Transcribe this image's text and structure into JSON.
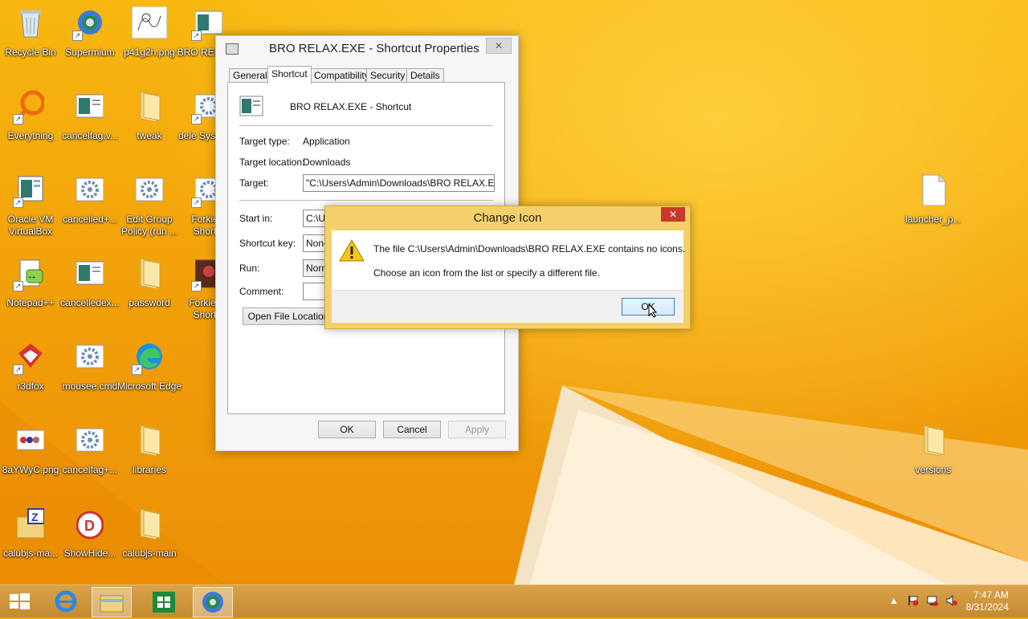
{
  "desktop_icons": [
    {
      "label": "Recycle Bin",
      "icon": "recycle-bin-icon"
    },
    {
      "label": "Supermium",
      "icon": "supermium-icon"
    },
    {
      "label": "p41g2h.png",
      "icon": "image-file-icon"
    },
    {
      "label": "BRO RELAX...",
      "icon": "exe-file-icon"
    },
    {
      "label": "Everything",
      "icon": "everything-search-icon"
    },
    {
      "label": "cancelfag.v...",
      "icon": "window-file-icon"
    },
    {
      "label": "tweak",
      "icon": "folder-icon"
    },
    {
      "label": "dele System...",
      "icon": "gear-file-icon"
    },
    {
      "label": "Oracle VM VirtualBox",
      "icon": "virtualbox-icon"
    },
    {
      "label": "cancelled+...",
      "icon": "gear-file-icon"
    },
    {
      "label": "Edit Group Policy (run ...",
      "icon": "gear-file-icon"
    },
    {
      "label": "Forkie... Short...",
      "icon": "gear-file-icon"
    },
    {
      "label": "Notepad++",
      "icon": "notepad-plus-plus-icon"
    },
    {
      "label": "cancelledex...",
      "icon": "window-file-icon"
    },
    {
      "label": "password",
      "icon": "folder-icon"
    },
    {
      "label": "Forkie.j... Short...",
      "icon": "image-file-icon"
    },
    {
      "label": "r3dfox",
      "icon": "r3dfox-icon"
    },
    {
      "label": "mousee.cmd",
      "icon": "gear-file-icon"
    },
    {
      "label": "Microsoft Edge",
      "icon": "edge-icon"
    },
    {
      "label": "8aYWyC.png",
      "icon": "image-file-icon"
    },
    {
      "label": "cancelfag+...",
      "icon": "gear-file-icon"
    },
    {
      "label": "libraries",
      "icon": "folder-icon"
    },
    {
      "label": "calubjs-ma...",
      "icon": "zip-folder-icon"
    },
    {
      "label": "ShowHide...",
      "icon": "showhide-icon"
    },
    {
      "label": "calubjs-main",
      "icon": "folder-icon"
    },
    {
      "label": "launcher_p...",
      "icon": "blank-file-icon"
    },
    {
      "label": "versions",
      "icon": "folder-icon"
    }
  ],
  "properties_window": {
    "title": "BRO RELAX.EXE - Shortcut Properties",
    "tabs": [
      "General",
      "Shortcut",
      "Compatibility",
      "Security",
      "Details"
    ],
    "active_tab": "Shortcut",
    "shortcut_name": "BRO RELAX.EXE - Shortcut",
    "labels": {
      "target_type": "Target type:",
      "target_location": "Target location:",
      "target": "Target:",
      "start_in": "Start in:",
      "shortcut_key": "Shortcut key:",
      "run": "Run:",
      "comment": "Comment:"
    },
    "values": {
      "target_type": "Application",
      "target_location": "Downloads",
      "target": "\"C:\\Users\\Admin\\Downloads\\BRO RELAX.EXE\"",
      "start_in": "C:\\Us",
      "shortcut_key": "None",
      "run": "Norm",
      "comment": ""
    },
    "open_file_location": "Open File Location",
    "buttons": {
      "ok": "OK",
      "cancel": "Cancel",
      "apply": "Apply"
    }
  },
  "change_icon_dialog": {
    "title": "Change Icon",
    "message_line1": "The file C:\\Users\\Admin\\Downloads\\BRO RELAX.EXE contains no icons.",
    "message_line2": "Choose an icon from the list or specify a different file.",
    "ok": "OK",
    "close_glyph": "✕"
  },
  "taskbar": {
    "items": [
      "start-button",
      "internet-explorer",
      "file-explorer",
      "store",
      "supermium"
    ],
    "clock_time": "7:47 AM",
    "clock_date": "8/31/2024"
  }
}
